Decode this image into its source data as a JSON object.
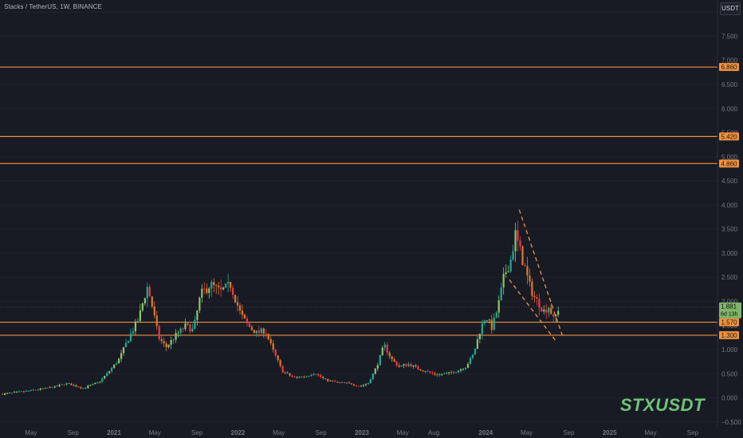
{
  "header": {
    "title": "Stacks / TetherUS, 1W, BINANCE",
    "unit": "USDT"
  },
  "watermark": "STXUSDT",
  "colors": {
    "bg": "#181b24",
    "up": "#22ab94",
    "up_alt": "#8cc66b",
    "down": "#f23645",
    "down_alt": "#e2772b",
    "level": "#f0913a",
    "axis_text": "#787b86",
    "grid": "#1f2330"
  },
  "chart_data": {
    "type": "candlestick",
    "title": "Stacks / TetherUS, 1W, BINANCE",
    "ylim": [
      -0.6,
      8.25
    ],
    "y_ticks": [
      -0.5,
      0,
      0.5,
      1,
      1.5,
      2,
      2.5,
      3,
      3.5,
      4,
      4.5,
      5,
      5.5,
      6,
      6.5,
      7,
      7.5,
      8
    ],
    "y_tick_labels": [
      "−0.500",
      "0.000",
      "0.500",
      "1.000",
      "1.500",
      "2.000",
      "2.500",
      "3.000",
      "3.500",
      "4.000",
      "4.500",
      "5.000",
      "5.500",
      "6.000",
      "6.500",
      "7.000",
      "7.500",
      "8.000"
    ],
    "x_ticks": [
      {
        "label": "May",
        "t": 2020.33
      },
      {
        "label": "Sep",
        "t": 2020.67
      },
      {
        "label": "2021",
        "t": 2021.0
      },
      {
        "label": "May",
        "t": 2021.33
      },
      {
        "label": "Sep",
        "t": 2021.67
      },
      {
        "label": "2022",
        "t": 2022.0
      },
      {
        "label": "May",
        "t": 2022.33
      },
      {
        "label": "Sep",
        "t": 2022.67
      },
      {
        "label": "2023",
        "t": 2023.0
      },
      {
        "label": "May",
        "t": 2023.33
      },
      {
        "label": "Aug",
        "t": 2023.58
      },
      {
        "label": "2024",
        "t": 2024.0
      },
      {
        "label": "May",
        "t": 2024.33
      },
      {
        "label": "Sep",
        "t": 2024.67
      },
      {
        "label": "2025",
        "t": 2025.0
      },
      {
        "label": "May",
        "t": 2025.33
      },
      {
        "label": "Sep",
        "t": 2025.67
      }
    ],
    "xlim": [
      2020.08,
      2025.87
    ],
    "price_levels": [
      {
        "value": 6.86,
        "label": "6.860"
      },
      {
        "value": 5.42,
        "label": "5.420"
      },
      {
        "value": 4.86,
        "label": "4.860"
      },
      {
        "value": 1.57,
        "label": "1.570"
      },
      {
        "value": 1.3,
        "label": "1.300"
      }
    ],
    "last_price": {
      "value": 1.881,
      "label": "1.881",
      "countdown": "6d 13h"
    },
    "wedge": {
      "upper": [
        [
          2024.27,
          3.9
        ],
        [
          2024.62,
          1.28
        ]
      ],
      "lower": [
        [
          2024.19,
          2.45
        ],
        [
          2024.56,
          1.2
        ]
      ]
    },
    "price_path": [
      [
        2020.1,
        0.08
      ],
      [
        2020.3,
        0.14
      ],
      [
        2020.5,
        0.22
      ],
      [
        2020.62,
        0.3
      ],
      [
        2020.75,
        0.2
      ],
      [
        2020.88,
        0.33
      ],
      [
        2020.96,
        0.55
      ],
      [
        2021.04,
        0.8
      ],
      [
        2021.12,
        1.25
      ],
      [
        2021.2,
        1.65
      ],
      [
        2021.24,
        2.05
      ],
      [
        2021.27,
        2.3
      ],
      [
        2021.3,
        2.0
      ],
      [
        2021.36,
        1.25
      ],
      [
        2021.42,
        1.05
      ],
      [
        2021.5,
        1.3
      ],
      [
        2021.58,
        1.5
      ],
      [
        2021.64,
        1.4
      ],
      [
        2021.7,
        2.15
      ],
      [
        2021.78,
        2.35
      ],
      [
        2021.86,
        2.2
      ],
      [
        2021.94,
        2.35
      ],
      [
        2022.02,
        1.75
      ],
      [
        2022.08,
        1.5
      ],
      [
        2022.15,
        1.35
      ],
      [
        2022.22,
        1.4
      ],
      [
        2022.28,
        1.0
      ],
      [
        2022.36,
        0.55
      ],
      [
        2022.45,
        0.42
      ],
      [
        2022.55,
        0.45
      ],
      [
        2022.62,
        0.52
      ],
      [
        2022.7,
        0.38
      ],
      [
        2022.8,
        0.32
      ],
      [
        2022.9,
        0.3
      ],
      [
        2022.98,
        0.24
      ],
      [
        2023.05,
        0.3
      ],
      [
        2023.12,
        0.65
      ],
      [
        2023.18,
        1.1
      ],
      [
        2023.24,
        0.8
      ],
      [
        2023.3,
        0.65
      ],
      [
        2023.38,
        0.7
      ],
      [
        2023.46,
        0.6
      ],
      [
        2023.52,
        0.55
      ],
      [
        2023.6,
        0.48
      ],
      [
        2023.68,
        0.5
      ],
      [
        2023.76,
        0.55
      ],
      [
        2023.84,
        0.65
      ],
      [
        2023.9,
        0.9
      ],
      [
        2023.96,
        1.45
      ],
      [
        2024.0,
        1.7
      ],
      [
        2024.05,
        1.45
      ],
      [
        2024.1,
        1.9
      ],
      [
        2024.15,
        2.55
      ],
      [
        2024.2,
        2.85
      ],
      [
        2024.24,
        3.4
      ],
      [
        2024.27,
        3.1
      ],
      [
        2024.31,
        2.75
      ],
      [
        2024.35,
        2.35
      ],
      [
        2024.39,
        2.1
      ],
      [
        2024.43,
        1.95
      ],
      [
        2024.47,
        1.8
      ],
      [
        2024.51,
        1.9
      ],
      [
        2024.55,
        1.6
      ],
      [
        2024.59,
        1.881
      ]
    ]
  }
}
